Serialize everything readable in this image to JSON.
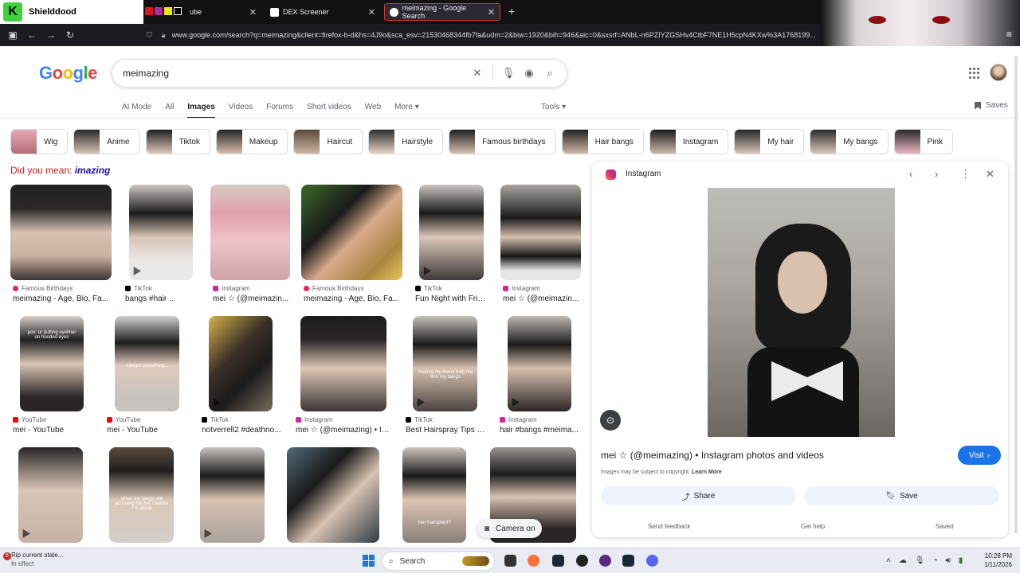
{
  "browser": {
    "extension_name": "Shielddood",
    "tabs": [
      {
        "label": "ube",
        "active": false
      },
      {
        "label": "DEX Screener",
        "active": false
      },
      {
        "label": "meimazing - Google Search",
        "active": true
      }
    ],
    "url": "www.google.com/search?q=meimazing&client=firefox-b-d&hs=4J9o&sca_esv=21530468344fb7fa&udm=2&biw=1920&bih=946&aic=0&sxsrf=ANbL-n6PZIYZGSHv4CtbF7NE1H5cpN4KXw%3A1768199..."
  },
  "google": {
    "logo": "Google",
    "query": "meimazing",
    "mode_tabs": [
      "AI Mode",
      "All",
      "Images",
      "Videos",
      "Forums",
      "Short videos",
      "Web",
      "More ▾"
    ],
    "tools": "Tools ▾",
    "saves": "Saves",
    "chips": [
      "Wig",
      "Anime",
      "Tiktok",
      "Makeup",
      "Haircut",
      "Hairstyle",
      "Famous birthdays",
      "Hair bangs",
      "Instagram",
      "My hair",
      "My bangs",
      "Pink"
    ],
    "did_you_mean_prefix": "Did you mean: ",
    "did_you_mean_term": "imazing",
    "camera_pill": "Camera on"
  },
  "results": [
    {
      "source": "Famous Birthdays",
      "title": "meimazing - Age, Bio, Fa..."
    },
    {
      "source": "TikTok",
      "title": "bangs #hair ..."
    },
    {
      "source": "Instagram",
      "title": "mei ☆ (@meimazin..."
    },
    {
      "source": "Famous Birthdays",
      "title": "meimazing - Age, Bio, Fa..."
    },
    {
      "source": "TikTok",
      "title": "Fun Night with Frie..."
    },
    {
      "source": "Instagram",
      "title": "mei ☆ (@meimazin..."
    },
    {
      "source": "YouTube",
      "title": "mei - YouTube"
    },
    {
      "source": "YouTube",
      "title": "mei - YouTube"
    },
    {
      "source": "TikTok",
      "title": "notverrell2 #deathno..."
    },
    {
      "source": "Instagram",
      "title": "mei ☆ (@meimazing) • In..."
    },
    {
      "source": "TikTok",
      "title": "Best Hairspray Tips f..."
    },
    {
      "source": "Instagram",
      "title": "hair #bangs #meima..."
    }
  ],
  "thumb_captions": [
    "pov: ur putting eyeliner on hooded eyes",
    "I forgot something...",
    "making my friend help me trim my bangs",
    "when my bangs are annoying me but I realize I'm alone",
    "hair transplant?"
  ],
  "preview": {
    "source": "Instagram",
    "title": "mei ☆ (@meimazing) • Instagram photos and videos",
    "visit": "Visit",
    "copyright_text": "Images may be subject to copyright. ",
    "learn_more": "Learn More",
    "share": "Share",
    "save": "Save",
    "send_feedback": "Send feedback",
    "get_help": "Get help",
    "saved": "Saved"
  },
  "taskbar": {
    "notification_title": "Rip current state...",
    "notification_sub": "In effect",
    "notification_count": "6",
    "search_placeholder": "Search",
    "time": "10:28 PM",
    "date": "1/11/2026"
  },
  "colors": {
    "link_blue": "#1a0dab",
    "correction_red": "#c5221f",
    "visit_blue": "#1a73e8",
    "active_tab_border": "#dd3333"
  }
}
